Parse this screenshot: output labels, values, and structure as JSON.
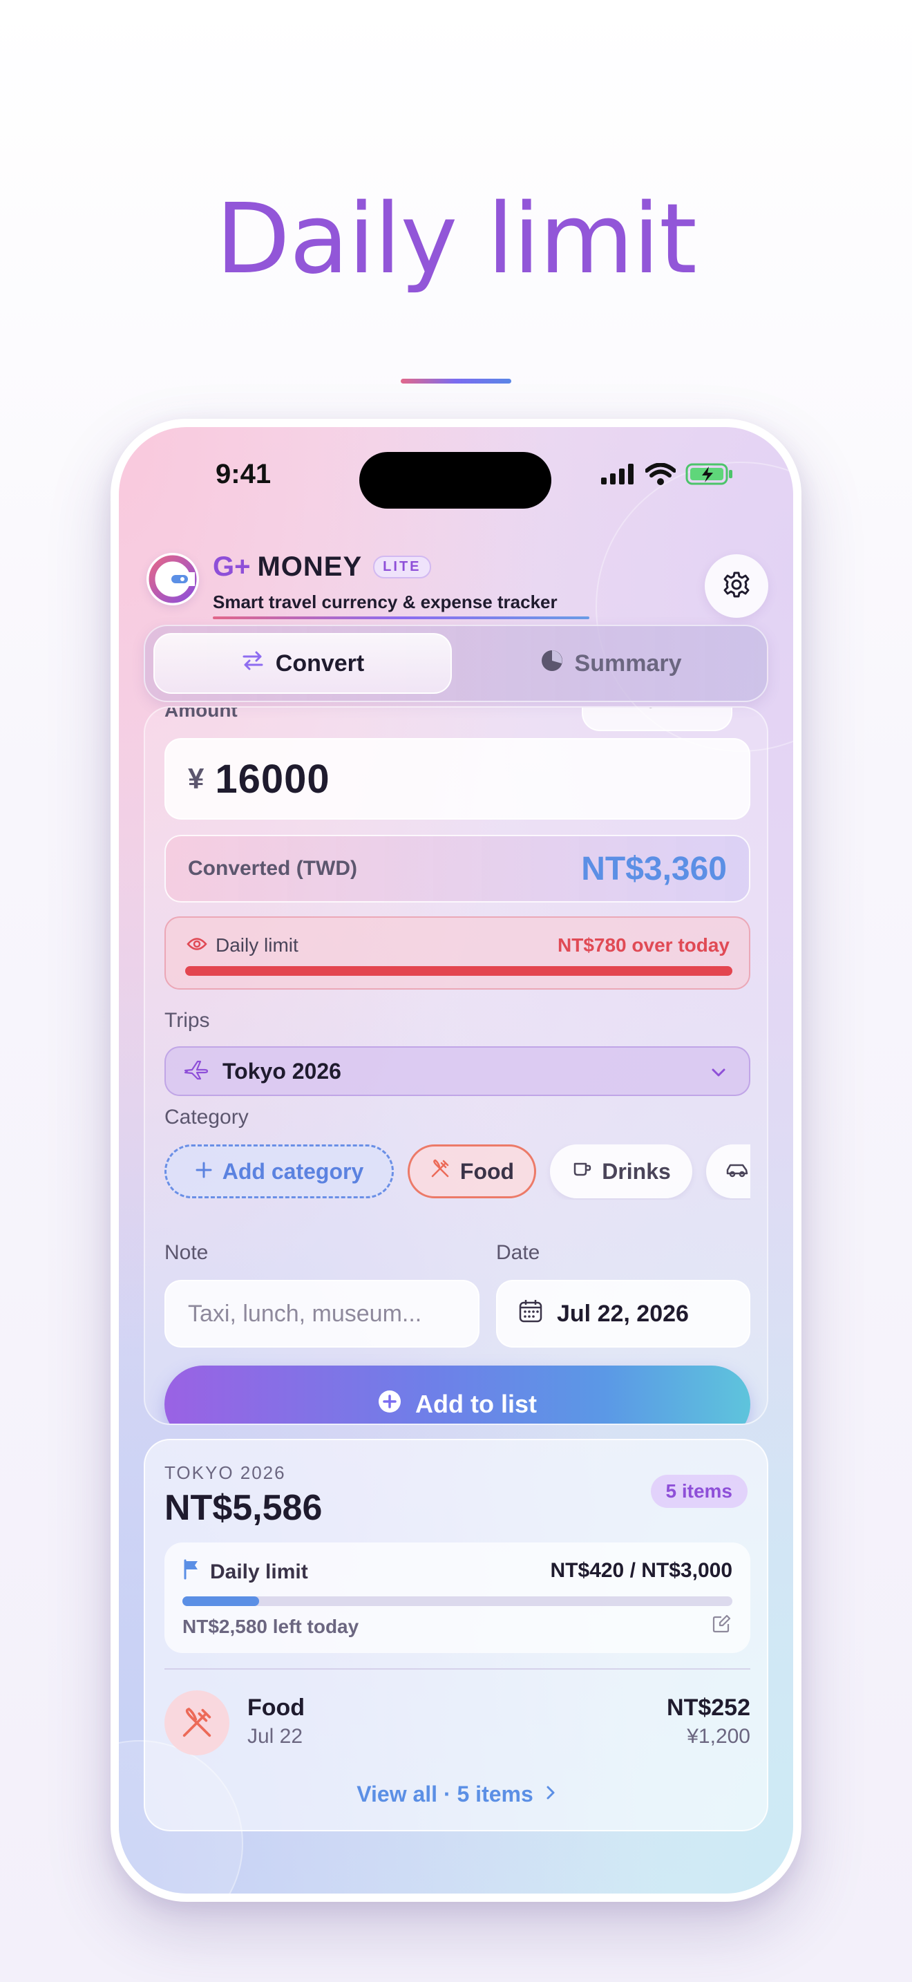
{
  "hero": {
    "title": "Daily limit"
  },
  "status_bar": {
    "time": "9:41",
    "icons": [
      "signal-icon",
      "wifi-icon",
      "battery-charging-icon"
    ]
  },
  "header": {
    "brand_prefix": "G+",
    "brand_name": "MONEY",
    "badge": "LITE",
    "tagline": "Smart travel currency & expense tracker",
    "icons": [
      "app-logo-icon",
      "gear-icon"
    ]
  },
  "tabs": [
    {
      "label": "Convert",
      "icon": "swap-icon",
      "active": true
    },
    {
      "label": "Summary",
      "icon": "pie-chart-icon",
      "active": false
    }
  ],
  "converter": {
    "amount_label": "Amount",
    "currency_code": "JPY",
    "currency_symbol": "¥",
    "amount_value": "16000",
    "converted_label": "Converted (TWD)",
    "converted_value": "NT$3,360",
    "daily_limit_label": "Daily limit",
    "daily_limit_status": "NT$780 over today",
    "daily_limit_fraction": 1.0,
    "trips_label": "Trips",
    "trip_selected": "Tokyo 2026",
    "category_label": "Category",
    "categories": [
      {
        "label": "Add category",
        "icon": "plus-icon"
      },
      {
        "label": "Food",
        "icon": "fork-knife-icon",
        "selected": true
      },
      {
        "label": "Drinks",
        "icon": "cup-icon"
      },
      {
        "label": "",
        "icon": "car-icon"
      }
    ],
    "note_label": "Note",
    "note_placeholder": "Taxi, lunch, museum...",
    "date_label": "Date",
    "date_value": "Jul 22, 2026",
    "add_button": "Add to list"
  },
  "summary": {
    "trip_name": "TOKYO 2026",
    "total": "NT$5,586",
    "items_count": "5 items",
    "daily_limit_label": "Daily limit",
    "daily_limit_value": "NT$420 / NT$3,000",
    "daily_limit_fraction": 0.14,
    "daily_limit_left": "NT$2,580 left today",
    "expense": {
      "category": "Food",
      "date": "Jul 22",
      "amount": "NT$252",
      "original": "¥1,200"
    },
    "view_all": "View all · 5 items"
  },
  "colors": {
    "accent_purple": "#9256d8",
    "accent_blue": "#5b8fe5",
    "warning_red": "#e3454f"
  }
}
